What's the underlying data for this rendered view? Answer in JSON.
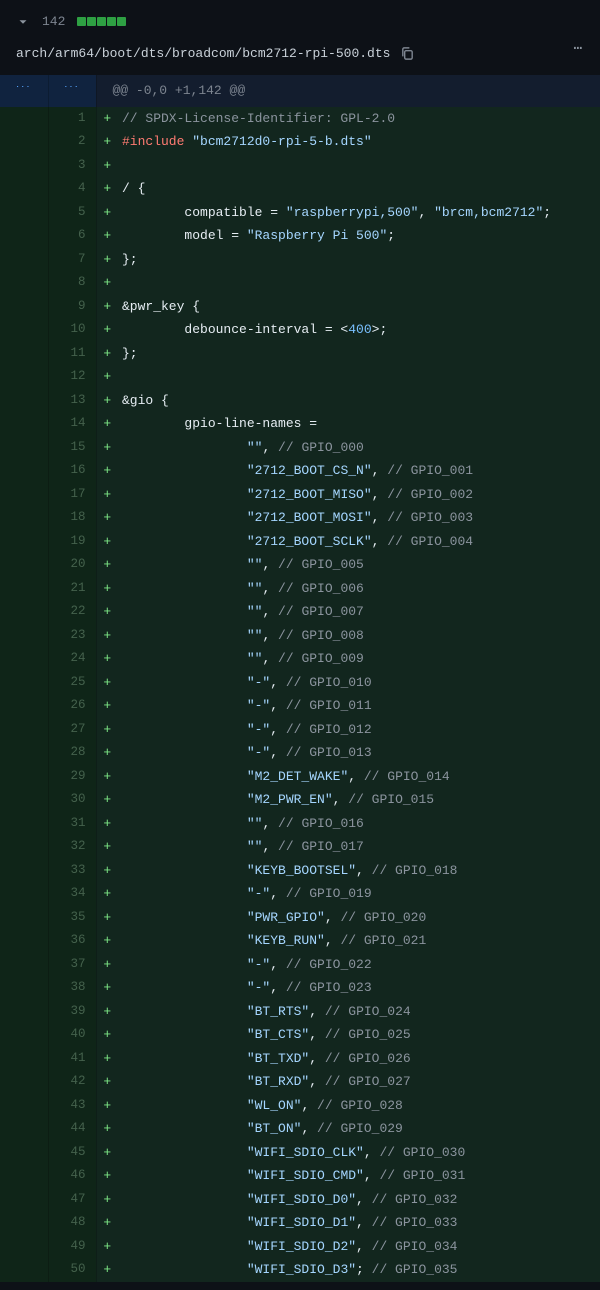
{
  "header": {
    "line_count": "142",
    "file_path": "arch/arm64/boot/dts/broadcom/bcm2712-rpi-500.dts"
  },
  "hunk": "@@ -0,0 +1,142 @@",
  "lines": [
    {
      "n": "1",
      "sign": "+",
      "segs": [
        {
          "t": "// SPDX-License-Identifier: GPL-2.0",
          "c": "c-comment"
        }
      ]
    },
    {
      "n": "2",
      "sign": "+",
      "segs": [
        {
          "t": "#include ",
          "c": "c-keyword"
        },
        {
          "t": "\"bcm2712d0-rpi-5-b.dts\"",
          "c": "c-string"
        }
      ]
    },
    {
      "n": "3",
      "sign": "+",
      "segs": []
    },
    {
      "n": "4",
      "sign": "+",
      "segs": [
        {
          "t": "/ {",
          "c": "c-punct"
        }
      ]
    },
    {
      "n": "5",
      "sign": "+",
      "segs": [
        {
          "t": "        compatible = ",
          "c": "c-prop"
        },
        {
          "t": "\"raspberrypi,500\"",
          "c": "c-string"
        },
        {
          "t": ", ",
          "c": "c-punct"
        },
        {
          "t": "\"brcm,bcm2712\"",
          "c": "c-string"
        },
        {
          "t": ";",
          "c": "c-punct"
        }
      ]
    },
    {
      "n": "6",
      "sign": "+",
      "segs": [
        {
          "t": "        model = ",
          "c": "c-prop"
        },
        {
          "t": "\"Raspberry Pi 500\"",
          "c": "c-string"
        },
        {
          "t": ";",
          "c": "c-punct"
        }
      ]
    },
    {
      "n": "7",
      "sign": "+",
      "segs": [
        {
          "t": "};",
          "c": "c-punct"
        }
      ]
    },
    {
      "n": "8",
      "sign": "+",
      "segs": []
    },
    {
      "n": "9",
      "sign": "+",
      "segs": [
        {
          "t": "&pwr_key {",
          "c": "c-ref"
        }
      ]
    },
    {
      "n": "10",
      "sign": "+",
      "segs": [
        {
          "t": "        debounce-interval = <",
          "c": "c-prop"
        },
        {
          "t": "400",
          "c": "c-number"
        },
        {
          "t": ">;",
          "c": "c-punct"
        }
      ]
    },
    {
      "n": "11",
      "sign": "+",
      "segs": [
        {
          "t": "};",
          "c": "c-punct"
        }
      ]
    },
    {
      "n": "12",
      "sign": "+",
      "segs": []
    },
    {
      "n": "13",
      "sign": "+",
      "segs": [
        {
          "t": "&gio {",
          "c": "c-ref"
        }
      ]
    },
    {
      "n": "14",
      "sign": "+",
      "segs": [
        {
          "t": "        gpio-line-names =",
          "c": "c-prop"
        }
      ]
    },
    {
      "n": "15",
      "sign": "+",
      "segs": [
        {
          "t": "                ",
          "c": ""
        },
        {
          "t": "\"\"",
          "c": "c-string"
        },
        {
          "t": ", ",
          "c": "c-punct"
        },
        {
          "t": "// GPIO_000",
          "c": "c-comment"
        }
      ]
    },
    {
      "n": "16",
      "sign": "+",
      "segs": [
        {
          "t": "                ",
          "c": ""
        },
        {
          "t": "\"2712_BOOT_CS_N\"",
          "c": "c-string"
        },
        {
          "t": ", ",
          "c": "c-punct"
        },
        {
          "t": "// GPIO_001",
          "c": "c-comment"
        }
      ]
    },
    {
      "n": "17",
      "sign": "+",
      "segs": [
        {
          "t": "                ",
          "c": ""
        },
        {
          "t": "\"2712_BOOT_MISO\"",
          "c": "c-string"
        },
        {
          "t": ", ",
          "c": "c-punct"
        },
        {
          "t": "// GPIO_002",
          "c": "c-comment"
        }
      ]
    },
    {
      "n": "18",
      "sign": "+",
      "segs": [
        {
          "t": "                ",
          "c": ""
        },
        {
          "t": "\"2712_BOOT_MOSI\"",
          "c": "c-string"
        },
        {
          "t": ", ",
          "c": "c-punct"
        },
        {
          "t": "// GPIO_003",
          "c": "c-comment"
        }
      ]
    },
    {
      "n": "19",
      "sign": "+",
      "segs": [
        {
          "t": "                ",
          "c": ""
        },
        {
          "t": "\"2712_BOOT_SCLK\"",
          "c": "c-string"
        },
        {
          "t": ", ",
          "c": "c-punct"
        },
        {
          "t": "// GPIO_004",
          "c": "c-comment"
        }
      ]
    },
    {
      "n": "20",
      "sign": "+",
      "segs": [
        {
          "t": "                ",
          "c": ""
        },
        {
          "t": "\"\"",
          "c": "c-string"
        },
        {
          "t": ", ",
          "c": "c-punct"
        },
        {
          "t": "// GPIO_005",
          "c": "c-comment"
        }
      ]
    },
    {
      "n": "21",
      "sign": "+",
      "segs": [
        {
          "t": "                ",
          "c": ""
        },
        {
          "t": "\"\"",
          "c": "c-string"
        },
        {
          "t": ", ",
          "c": "c-punct"
        },
        {
          "t": "// GPIO_006",
          "c": "c-comment"
        }
      ]
    },
    {
      "n": "22",
      "sign": "+",
      "segs": [
        {
          "t": "                ",
          "c": ""
        },
        {
          "t": "\"\"",
          "c": "c-string"
        },
        {
          "t": ", ",
          "c": "c-punct"
        },
        {
          "t": "// GPIO_007",
          "c": "c-comment"
        }
      ]
    },
    {
      "n": "23",
      "sign": "+",
      "segs": [
        {
          "t": "                ",
          "c": ""
        },
        {
          "t": "\"\"",
          "c": "c-string"
        },
        {
          "t": ", ",
          "c": "c-punct"
        },
        {
          "t": "// GPIO_008",
          "c": "c-comment"
        }
      ]
    },
    {
      "n": "24",
      "sign": "+",
      "segs": [
        {
          "t": "                ",
          "c": ""
        },
        {
          "t": "\"\"",
          "c": "c-string"
        },
        {
          "t": ", ",
          "c": "c-punct"
        },
        {
          "t": "// GPIO_009",
          "c": "c-comment"
        }
      ]
    },
    {
      "n": "25",
      "sign": "+",
      "segs": [
        {
          "t": "                ",
          "c": ""
        },
        {
          "t": "\"-\"",
          "c": "c-string"
        },
        {
          "t": ", ",
          "c": "c-punct"
        },
        {
          "t": "// GPIO_010",
          "c": "c-comment"
        }
      ]
    },
    {
      "n": "26",
      "sign": "+",
      "segs": [
        {
          "t": "                ",
          "c": ""
        },
        {
          "t": "\"-\"",
          "c": "c-string"
        },
        {
          "t": ", ",
          "c": "c-punct"
        },
        {
          "t": "// GPIO_011",
          "c": "c-comment"
        }
      ]
    },
    {
      "n": "27",
      "sign": "+",
      "segs": [
        {
          "t": "                ",
          "c": ""
        },
        {
          "t": "\"-\"",
          "c": "c-string"
        },
        {
          "t": ", ",
          "c": "c-punct"
        },
        {
          "t": "// GPIO_012",
          "c": "c-comment"
        }
      ]
    },
    {
      "n": "28",
      "sign": "+",
      "segs": [
        {
          "t": "                ",
          "c": ""
        },
        {
          "t": "\"-\"",
          "c": "c-string"
        },
        {
          "t": ", ",
          "c": "c-punct"
        },
        {
          "t": "// GPIO_013",
          "c": "c-comment"
        }
      ]
    },
    {
      "n": "29",
      "sign": "+",
      "segs": [
        {
          "t": "                ",
          "c": ""
        },
        {
          "t": "\"M2_DET_WAKE\"",
          "c": "c-string"
        },
        {
          "t": ", ",
          "c": "c-punct"
        },
        {
          "t": "// GPIO_014",
          "c": "c-comment"
        }
      ]
    },
    {
      "n": "30",
      "sign": "+",
      "segs": [
        {
          "t": "                ",
          "c": ""
        },
        {
          "t": "\"M2_PWR_EN\"",
          "c": "c-string"
        },
        {
          "t": ", ",
          "c": "c-punct"
        },
        {
          "t": "// GPIO_015",
          "c": "c-comment"
        }
      ]
    },
    {
      "n": "31",
      "sign": "+",
      "segs": [
        {
          "t": "                ",
          "c": ""
        },
        {
          "t": "\"\"",
          "c": "c-string"
        },
        {
          "t": ", ",
          "c": "c-punct"
        },
        {
          "t": "// GPIO_016",
          "c": "c-comment"
        }
      ]
    },
    {
      "n": "32",
      "sign": "+",
      "segs": [
        {
          "t": "                ",
          "c": ""
        },
        {
          "t": "\"\"",
          "c": "c-string"
        },
        {
          "t": ", ",
          "c": "c-punct"
        },
        {
          "t": "// GPIO_017",
          "c": "c-comment"
        }
      ]
    },
    {
      "n": "33",
      "sign": "+",
      "segs": [
        {
          "t": "                ",
          "c": ""
        },
        {
          "t": "\"KEYB_BOOTSEL\"",
          "c": "c-string"
        },
        {
          "t": ", ",
          "c": "c-punct"
        },
        {
          "t": "// GPIO_018",
          "c": "c-comment"
        }
      ]
    },
    {
      "n": "34",
      "sign": "+",
      "segs": [
        {
          "t": "                ",
          "c": ""
        },
        {
          "t": "\"-\"",
          "c": "c-string"
        },
        {
          "t": ", ",
          "c": "c-punct"
        },
        {
          "t": "// GPIO_019",
          "c": "c-comment"
        }
      ]
    },
    {
      "n": "35",
      "sign": "+",
      "segs": [
        {
          "t": "                ",
          "c": ""
        },
        {
          "t": "\"PWR_GPIO\"",
          "c": "c-string"
        },
        {
          "t": ", ",
          "c": "c-punct"
        },
        {
          "t": "// GPIO_020",
          "c": "c-comment"
        }
      ]
    },
    {
      "n": "36",
      "sign": "+",
      "segs": [
        {
          "t": "                ",
          "c": ""
        },
        {
          "t": "\"KEYB_RUN\"",
          "c": "c-string"
        },
        {
          "t": ", ",
          "c": "c-punct"
        },
        {
          "t": "// GPIO_021",
          "c": "c-comment"
        }
      ]
    },
    {
      "n": "37",
      "sign": "+",
      "segs": [
        {
          "t": "                ",
          "c": ""
        },
        {
          "t": "\"-\"",
          "c": "c-string"
        },
        {
          "t": ", ",
          "c": "c-punct"
        },
        {
          "t": "// GPIO_022",
          "c": "c-comment"
        }
      ]
    },
    {
      "n": "38",
      "sign": "+",
      "segs": [
        {
          "t": "                ",
          "c": ""
        },
        {
          "t": "\"-\"",
          "c": "c-string"
        },
        {
          "t": ", ",
          "c": "c-punct"
        },
        {
          "t": "// GPIO_023",
          "c": "c-comment"
        }
      ]
    },
    {
      "n": "39",
      "sign": "+",
      "segs": [
        {
          "t": "                ",
          "c": ""
        },
        {
          "t": "\"BT_RTS\"",
          "c": "c-string"
        },
        {
          "t": ", ",
          "c": "c-punct"
        },
        {
          "t": "// GPIO_024",
          "c": "c-comment"
        }
      ]
    },
    {
      "n": "40",
      "sign": "+",
      "segs": [
        {
          "t": "                ",
          "c": ""
        },
        {
          "t": "\"BT_CTS\"",
          "c": "c-string"
        },
        {
          "t": ", ",
          "c": "c-punct"
        },
        {
          "t": "// GPIO_025",
          "c": "c-comment"
        }
      ]
    },
    {
      "n": "41",
      "sign": "+",
      "segs": [
        {
          "t": "                ",
          "c": ""
        },
        {
          "t": "\"BT_TXD\"",
          "c": "c-string"
        },
        {
          "t": ", ",
          "c": "c-punct"
        },
        {
          "t": "// GPIO_026",
          "c": "c-comment"
        }
      ]
    },
    {
      "n": "42",
      "sign": "+",
      "segs": [
        {
          "t": "                ",
          "c": ""
        },
        {
          "t": "\"BT_RXD\"",
          "c": "c-string"
        },
        {
          "t": ", ",
          "c": "c-punct"
        },
        {
          "t": "// GPIO_027",
          "c": "c-comment"
        }
      ]
    },
    {
      "n": "43",
      "sign": "+",
      "segs": [
        {
          "t": "                ",
          "c": ""
        },
        {
          "t": "\"WL_ON\"",
          "c": "c-string"
        },
        {
          "t": ", ",
          "c": "c-punct"
        },
        {
          "t": "// GPIO_028",
          "c": "c-comment"
        }
      ]
    },
    {
      "n": "44",
      "sign": "+",
      "segs": [
        {
          "t": "                ",
          "c": ""
        },
        {
          "t": "\"BT_ON\"",
          "c": "c-string"
        },
        {
          "t": ", ",
          "c": "c-punct"
        },
        {
          "t": "// GPIO_029",
          "c": "c-comment"
        }
      ]
    },
    {
      "n": "45",
      "sign": "+",
      "segs": [
        {
          "t": "                ",
          "c": ""
        },
        {
          "t": "\"WIFI_SDIO_CLK\"",
          "c": "c-string"
        },
        {
          "t": ", ",
          "c": "c-punct"
        },
        {
          "t": "// GPIO_030",
          "c": "c-comment"
        }
      ]
    },
    {
      "n": "46",
      "sign": "+",
      "segs": [
        {
          "t": "                ",
          "c": ""
        },
        {
          "t": "\"WIFI_SDIO_CMD\"",
          "c": "c-string"
        },
        {
          "t": ", ",
          "c": "c-punct"
        },
        {
          "t": "// GPIO_031",
          "c": "c-comment"
        }
      ]
    },
    {
      "n": "47",
      "sign": "+",
      "segs": [
        {
          "t": "                ",
          "c": ""
        },
        {
          "t": "\"WIFI_SDIO_D0\"",
          "c": "c-string"
        },
        {
          "t": ", ",
          "c": "c-punct"
        },
        {
          "t": "// GPIO_032",
          "c": "c-comment"
        }
      ]
    },
    {
      "n": "48",
      "sign": "+",
      "segs": [
        {
          "t": "                ",
          "c": ""
        },
        {
          "t": "\"WIFI_SDIO_D1\"",
          "c": "c-string"
        },
        {
          "t": ", ",
          "c": "c-punct"
        },
        {
          "t": "// GPIO_033",
          "c": "c-comment"
        }
      ]
    },
    {
      "n": "49",
      "sign": "+",
      "segs": [
        {
          "t": "                ",
          "c": ""
        },
        {
          "t": "\"WIFI_SDIO_D2\"",
          "c": "c-string"
        },
        {
          "t": ", ",
          "c": "c-punct"
        },
        {
          "t": "// GPIO_034",
          "c": "c-comment"
        }
      ]
    },
    {
      "n": "50",
      "sign": "+",
      "segs": [
        {
          "t": "                ",
          "c": ""
        },
        {
          "t": "\"WIFI_SDIO_D3\"",
          "c": "c-string"
        },
        {
          "t": "; ",
          "c": "c-punct"
        },
        {
          "t": "// GPIO_035",
          "c": "c-comment"
        }
      ]
    }
  ]
}
